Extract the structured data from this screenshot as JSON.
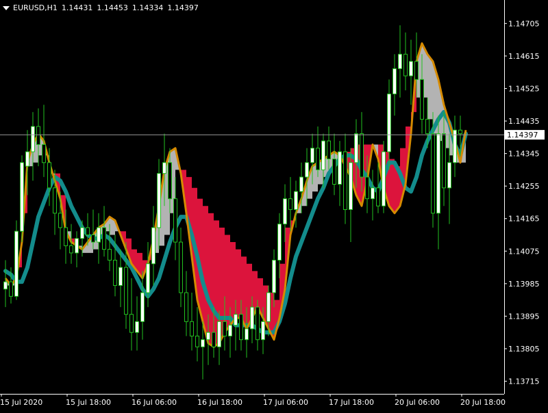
{
  "header": {
    "symbol": "EURUSD,H1",
    "open": "1.14431",
    "high": "1.14453",
    "low": "1.14334",
    "close": "1.14397"
  },
  "colors": {
    "background": "#000000",
    "axis": "#ffffff",
    "candle_wick": "#22c21f",
    "candle_body_bull": "#ffffff",
    "candle_body_bear": "#000000",
    "fill_up": "#b3b3b3",
    "fill_down": "#dc143c",
    "channel_line": "#d58a00",
    "slow_ma": "#138c8c",
    "current_price_line": "#9a9a9a",
    "current_price_label_bg": "#ffffff",
    "current_price_label_text": "#000000"
  },
  "chart_data": {
    "type": "candlestick",
    "title": "EURUSD,H1",
    "ylim": [
      1.1368,
      1.1477
    ],
    "y_ticks": [
      "1.14705",
      "1.14615",
      "1.14525",
      "1.14435",
      "1.14345",
      "1.14255",
      "1.14165",
      "1.14075",
      "1.13985",
      "1.13895",
      "1.13805",
      "1.13715"
    ],
    "x_ticks": [
      "15 Jul 2020",
      "15 Jul 18:00",
      "16 Jul 06:00",
      "16 Jul 18:00",
      "17 Jul 06:00",
      "17 Jul 18:00",
      "20 Jul 06:00",
      "20 Jul 18:00"
    ],
    "x_tick_bars": [
      0,
      12,
      24,
      36,
      48,
      60,
      72,
      84
    ],
    "current_price": "1.14397",
    "fast_line": [
      1.14,
      1.1398,
      1.14,
      1.141,
      1.1432,
      1.1437,
      1.144,
      1.1438,
      1.1432,
      1.1427,
      1.1422,
      1.1413,
      1.141,
      1.1409,
      1.1408,
      1.141,
      1.1412,
      1.1414,
      1.1415,
      1.1417,
      1.1416,
      1.1412,
      1.1408,
      1.1404,
      1.1402,
      1.14,
      1.1404,
      1.1411,
      1.142,
      1.143,
      1.1435,
      1.1436,
      1.1429,
      1.1418,
      1.1406,
      1.1394,
      1.1388,
      1.1382,
      1.1381,
      1.1382,
      1.1385,
      1.1387,
      1.1389,
      1.1389,
      1.1386,
      1.1389,
      1.1392,
      1.1389,
      1.1386,
      1.1383,
      1.1389,
      1.1397,
      1.1412,
      1.1418,
      1.1422,
      1.1427,
      1.1431,
      1.1432,
      1.1433,
      1.1434,
      1.1435,
      1.1434,
      1.1431,
      1.1428,
      1.1423,
      1.142,
      1.1427,
      1.1437,
      1.1433,
      1.1425,
      1.142,
      1.1418,
      1.142,
      1.1426,
      1.144,
      1.146,
      1.1465,
      1.1462,
      1.146,
      1.1455,
      1.1448,
      1.1443,
      1.1438,
      1.1432,
      1.1441
    ],
    "fill_line": [
      1.1398,
      1.1398,
      1.1403,
      1.1418,
      1.1431,
      1.1432,
      1.1434,
      1.1434,
      1.1429,
      1.1429,
      1.1423,
      1.1413,
      1.1411,
      1.1409,
      1.1407,
      1.1407,
      1.1408,
      1.1411,
      1.1413,
      1.1412,
      1.1413,
      1.1413,
      1.1411,
      1.1408,
      1.1407,
      1.1405,
      1.1405,
      1.1407,
      1.1409,
      1.1412,
      1.1418,
      1.143,
      1.143,
      1.1428,
      1.1425,
      1.1422,
      1.142,
      1.1418,
      1.1416,
      1.1414,
      1.1412,
      1.141,
      1.1408,
      1.1406,
      1.1404,
      1.1402,
      1.14,
      1.1398,
      1.1396,
      1.1394,
      1.1404,
      1.1414,
      1.1416,
      1.1418,
      1.142,
      1.1422,
      1.1424,
      1.1426,
      1.1428,
      1.143,
      1.1432,
      1.1434,
      1.1435,
      1.1436,
      1.1437,
      1.1437,
      1.1437,
      1.1437,
      1.1437,
      1.1435,
      1.1433,
      1.1431,
      1.1436,
      1.1442,
      1.1446,
      1.145,
      1.145,
      1.1444,
      1.144,
      1.1438,
      1.1436,
      1.1434,
      1.1432,
      1.1432,
      1.144
    ],
    "slow_ma": [
      1.1402,
      1.1401,
      1.1399,
      1.1399,
      1.1403,
      1.141,
      1.1417,
      1.1421,
      1.1425,
      1.1428,
      1.1427,
      1.1424,
      1.142,
      1.1417,
      1.1414,
      1.1412,
      1.1411,
      1.1411,
      1.1412,
      1.1411,
      1.1409,
      1.1407,
      1.1405,
      1.1403,
      1.14,
      1.1397,
      1.1395,
      1.1397,
      1.14,
      1.1405,
      1.141,
      1.1414,
      1.1417,
      1.1417,
      1.1412,
      1.1406,
      1.1399,
      1.1394,
      1.1391,
      1.1389,
      1.1389,
      1.1389,
      1.1387,
      1.1387,
      1.1387,
      1.1387,
      1.1386,
      1.1385,
      1.1385,
      1.1385,
      1.1388,
      1.1393,
      1.14,
      1.1406,
      1.141,
      1.1414,
      1.1418,
      1.1422,
      1.1425,
      1.1429,
      1.1431,
      1.1433,
      1.1434,
      1.1434,
      1.1433,
      1.143,
      1.1428,
      1.1425,
      1.1424,
      1.1428,
      1.1432,
      1.1432,
      1.1429,
      1.1425,
      1.1424,
      1.1428,
      1.1434,
      1.1438,
      1.1441,
      1.1444,
      1.1446,
      1.1443,
      1.1437,
      1.1434,
      1.144
    ],
    "candles": [
      [
        1.1397,
        1.1405,
        1.1392,
        1.1399
      ],
      [
        1.1399,
        1.1403,
        1.1393,
        1.1395
      ],
      [
        1.1395,
        1.1416,
        1.1394,
        1.1413
      ],
      [
        1.1413,
        1.1434,
        1.141,
        1.1432
      ],
      [
        1.1431,
        1.1441,
        1.1423,
        1.1435
      ],
      [
        1.1435,
        1.1446,
        1.1427,
        1.1442
      ],
      [
        1.1442,
        1.1447,
        1.1431,
        1.1437
      ],
      [
        1.1437,
        1.1448,
        1.1428,
        1.1432
      ],
      [
        1.1432,
        1.1436,
        1.142,
        1.1425
      ],
      [
        1.1425,
        1.143,
        1.1412,
        1.1418
      ],
      [
        1.1418,
        1.1424,
        1.1408,
        1.1414
      ],
      [
        1.1414,
        1.1419,
        1.1404,
        1.1409
      ],
      [
        1.1409,
        1.1415,
        1.1404,
        1.1407
      ],
      [
        1.1407,
        1.1413,
        1.1403,
        1.1411
      ],
      [
        1.1411,
        1.1416,
        1.1406,
        1.1414
      ],
      [
        1.1414,
        1.1418,
        1.1409,
        1.1412
      ],
      [
        1.1412,
        1.1419,
        1.1408,
        1.141
      ],
      [
        1.141,
        1.1418,
        1.1404,
        1.1414
      ],
      [
        1.1414,
        1.142,
        1.1406,
        1.1408
      ],
      [
        1.1408,
        1.1415,
        1.1402,
        1.1405
      ],
      [
        1.1405,
        1.1412,
        1.1395,
        1.1398
      ],
      [
        1.1398,
        1.1408,
        1.1392,
        1.1403
      ],
      [
        1.1403,
        1.141,
        1.1386,
        1.139
      ],
      [
        1.139,
        1.14,
        1.138,
        1.1385
      ],
      [
        1.1385,
        1.1395,
        1.138,
        1.1388
      ],
      [
        1.1388,
        1.1402,
        1.1383,
        1.1396
      ],
      [
        1.1396,
        1.141,
        1.1392,
        1.1404
      ],
      [
        1.1404,
        1.142,
        1.1398,
        1.1414
      ],
      [
        1.1414,
        1.1433,
        1.1408,
        1.1429
      ],
      [
        1.1429,
        1.144,
        1.142,
        1.1432
      ],
      [
        1.1432,
        1.1436,
        1.1418,
        1.1422
      ],
      [
        1.1422,
        1.1428,
        1.1405,
        1.141
      ],
      [
        1.141,
        1.1414,
        1.1392,
        1.1396
      ],
      [
        1.1396,
        1.1402,
        1.1384,
        1.1388
      ],
      [
        1.1388,
        1.1396,
        1.138,
        1.1384
      ],
      [
        1.1384,
        1.1392,
        1.1377,
        1.1381
      ],
      [
        1.1381,
        1.1388,
        1.1372,
        1.1383
      ],
      [
        1.1383,
        1.139,
        1.1376,
        1.1385
      ],
      [
        1.1385,
        1.1392,
        1.1378,
        1.1381
      ],
      [
        1.1381,
        1.1391,
        1.1376,
        1.1388
      ],
      [
        1.1388,
        1.1395,
        1.138,
        1.1384
      ],
      [
        1.1384,
        1.1392,
        1.1378,
        1.1387
      ],
      [
        1.1387,
        1.1394,
        1.138,
        1.139
      ],
      [
        1.139,
        1.1394,
        1.138,
        1.1383
      ],
      [
        1.1383,
        1.1392,
        1.1378,
        1.1386
      ],
      [
        1.1386,
        1.1395,
        1.1382,
        1.1392
      ],
      [
        1.1392,
        1.1394,
        1.138,
        1.1383
      ],
      [
        1.1383,
        1.1392,
        1.1379,
        1.1388
      ],
      [
        1.1388,
        1.1398,
        1.1384,
        1.1396
      ],
      [
        1.1396,
        1.1408,
        1.1392,
        1.1405
      ],
      [
        1.1405,
        1.1418,
        1.14,
        1.1415
      ],
      [
        1.1415,
        1.1426,
        1.141,
        1.1422
      ],
      [
        1.1422,
        1.1428,
        1.1413,
        1.1419
      ],
      [
        1.1419,
        1.1427,
        1.1414,
        1.1424
      ],
      [
        1.1424,
        1.1432,
        1.1418,
        1.1428
      ],
      [
        1.1428,
        1.1436,
        1.142,
        1.1432
      ],
      [
        1.1432,
        1.144,
        1.1426,
        1.1436
      ],
      [
        1.1436,
        1.1442,
        1.1428,
        1.143
      ],
      [
        1.143,
        1.144,
        1.1425,
        1.1438
      ],
      [
        1.1438,
        1.1442,
        1.143,
        1.1433
      ],
      [
        1.1433,
        1.144,
        1.1423,
        1.1426
      ],
      [
        1.1426,
        1.1438,
        1.142,
        1.1435
      ],
      [
        1.1435,
        1.144,
        1.1415,
        1.1419
      ],
      [
        1.1419,
        1.1436,
        1.141,
        1.1432
      ],
      [
        1.1432,
        1.1444,
        1.1425,
        1.144
      ],
      [
        1.144,
        1.1446,
        1.1424,
        1.1428
      ],
      [
        1.1428,
        1.1434,
        1.1418,
        1.1422
      ],
      [
        1.1422,
        1.143,
        1.1416,
        1.1425
      ],
      [
        1.1425,
        1.1432,
        1.1418,
        1.142
      ],
      [
        1.142,
        1.1438,
        1.1418,
        1.1435
      ],
      [
        1.1435,
        1.1455,
        1.143,
        1.1451
      ],
      [
        1.1451,
        1.1462,
        1.1445,
        1.1458
      ],
      [
        1.1458,
        1.147,
        1.145,
        1.1462
      ],
      [
        1.1462,
        1.1468,
        1.1452,
        1.1456
      ],
      [
        1.1456,
        1.1466,
        1.1448,
        1.146
      ],
      [
        1.146,
        1.1468,
        1.145,
        1.1455
      ],
      [
        1.1455,
        1.1462,
        1.144,
        1.1444
      ],
      [
        1.1444,
        1.145,
        1.1436,
        1.144
      ],
      [
        1.144,
        1.1446,
        1.1414,
        1.1418
      ],
      [
        1.1418,
        1.1445,
        1.1408,
        1.144
      ],
      [
        1.144,
        1.1446,
        1.142,
        1.1425
      ],
      [
        1.1425,
        1.144,
        1.1415,
        1.1432
      ],
      [
        1.1432,
        1.1445,
        1.1428,
        1.1441
      ],
      [
        1.1441,
        1.1445,
        1.1434,
        1.144
      ]
    ]
  }
}
